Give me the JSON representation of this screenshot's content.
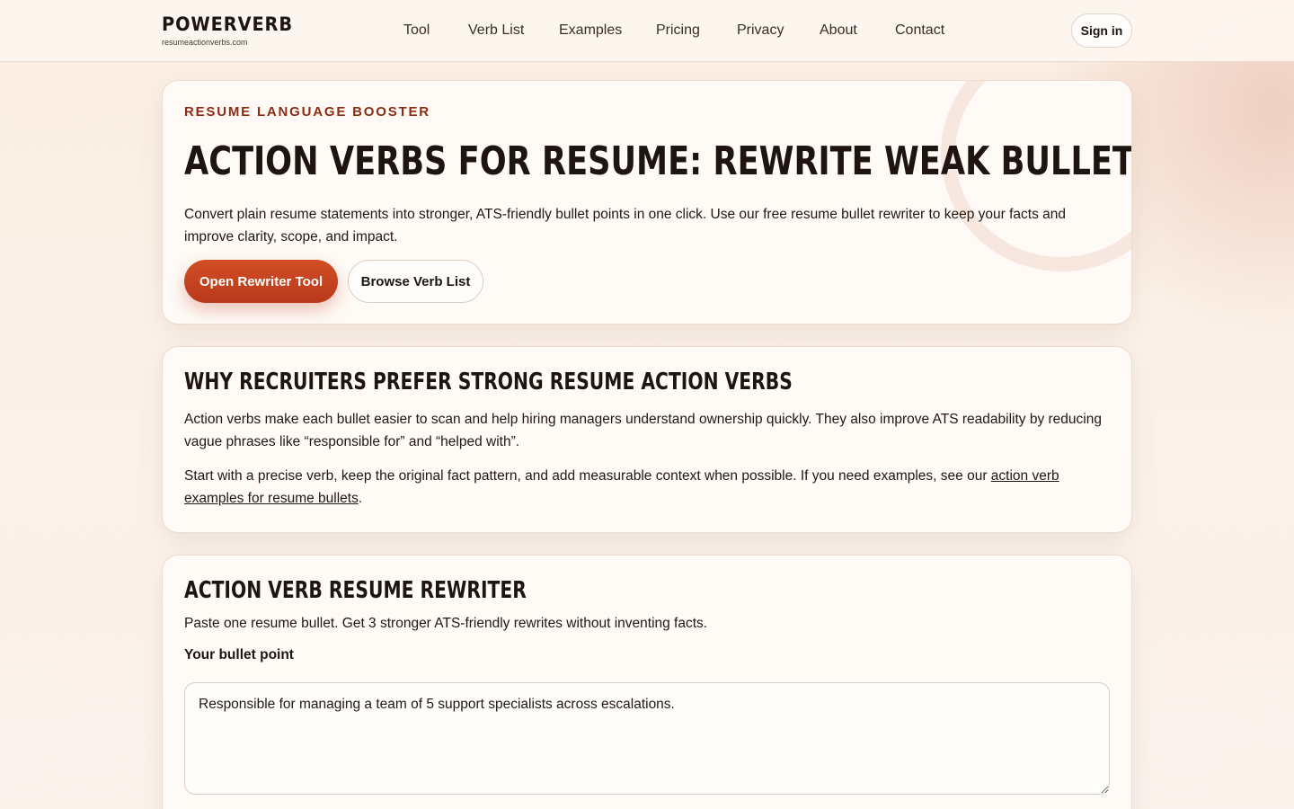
{
  "header": {
    "logo_name": "POWERVERB",
    "logo_domain": "resumeactionverbs.com",
    "nav": [
      {
        "label": "Tool"
      },
      {
        "label": "Verb List"
      },
      {
        "label": "Examples"
      },
      {
        "label": "Pricing"
      },
      {
        "label": "Privacy"
      },
      {
        "label": "About"
      },
      {
        "label": "Contact"
      }
    ],
    "signin_label": "Sign in"
  },
  "hero": {
    "eyebrow": "RESUME LANGUAGE BOOSTER",
    "title": "Action Verbs for Resume: Rewrite Weak Bullets Fast",
    "description": "Convert plain resume statements into stronger, ATS-friendly bullet points in one click. Use our free resume bullet rewriter to keep your facts and improve clarity, scope, and impact.",
    "primary_button": "Open Rewriter Tool",
    "secondary_button": "Browse Verb List"
  },
  "why": {
    "title": "Why recruiters prefer strong resume action verbs",
    "p1": "Action verbs make each bullet easier to scan and help hiring managers understand ownership quickly. They also improve ATS readability by reducing vague phrases like “responsible for” and “helped with”.",
    "p2_before": "Start with a precise verb, keep the original fact pattern, and add measurable context when possible. If you need examples, see our ",
    "p2_link": "action verb examples for resume bullets",
    "p2_after": "."
  },
  "rewriter": {
    "title": "Action verb resume rewriter",
    "subtitle": "Paste one resume bullet. Get 3 stronger ATS-friendly rewrites without inventing facts.",
    "input_label": "Your bullet point",
    "input_value": "Responsible for managing a team of 5 support specialists across escalations."
  },
  "colors": {
    "accent": "#c6421f",
    "eyebrow": "#8a2d14",
    "text": "#1f1410"
  }
}
